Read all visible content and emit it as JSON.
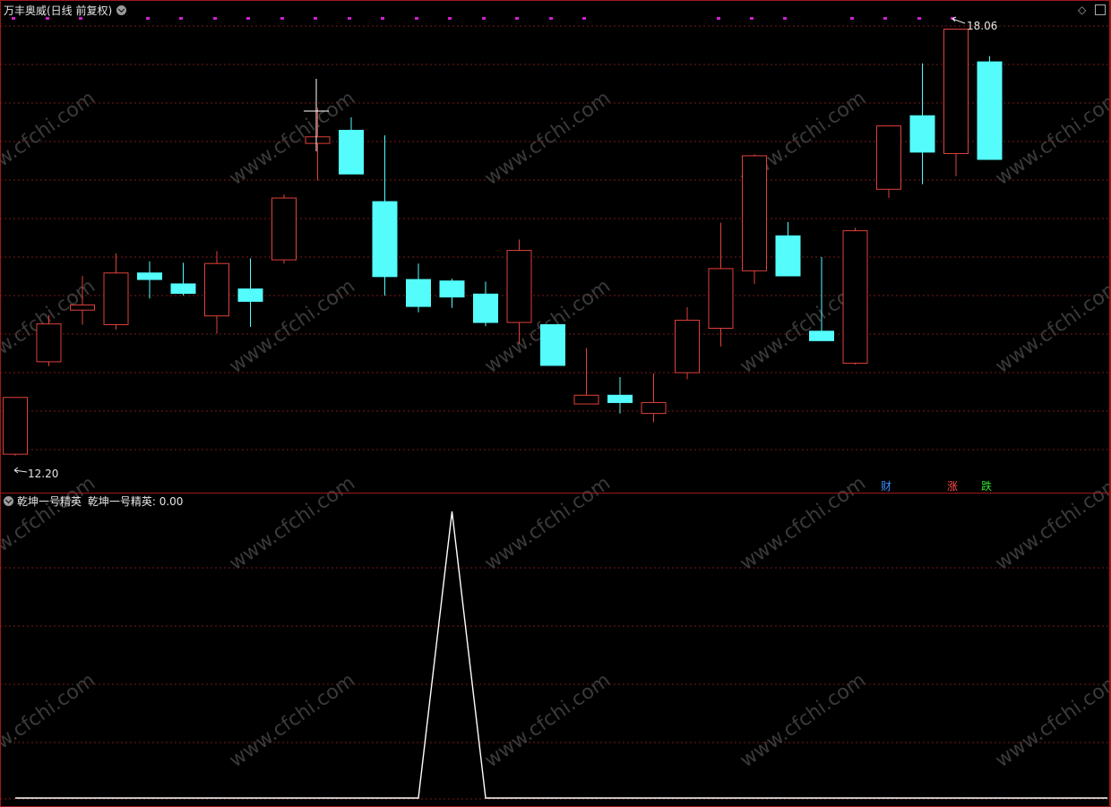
{
  "main_panel": {
    "title": "万丰奥威(日线 前复权)",
    "high_label": "18.06",
    "low_label": "12.20",
    "markers": [
      {
        "text": "财",
        "color": "#3f8cff"
      },
      {
        "text": "涨",
        "color": "#ff4b4b"
      },
      {
        "text": "跌",
        "color": "#2fdf2f"
      }
    ]
  },
  "indicator_panel": {
    "title": "乾坤一号精英",
    "value_label": "乾坤一号精英: 0.00"
  },
  "watermark": "www.cfchi.com",
  "colors": {
    "up": "#e0413a",
    "down": "#54fcfc",
    "grid": "#7a1a1a",
    "border": "#a01818",
    "dot": "#d21ed2",
    "line": "#ffffff"
  },
  "chart_data": [
    {
      "type": "candlestick",
      "title": "万丰奥威(日线 前复权)",
      "ylim": [
        12.0,
        18.3
      ],
      "candles": [
        {
          "o": 12.22,
          "h": 13.0,
          "l": 12.2,
          "c": 13.0,
          "dir": "up"
        },
        {
          "o": 13.49,
          "h": 14.13,
          "l": 13.43,
          "c": 14.01,
          "dir": "up"
        },
        {
          "o": 14.2,
          "h": 14.67,
          "l": 14.0,
          "c": 14.27,
          "dir": "up"
        },
        {
          "o": 14.0,
          "h": 14.98,
          "l": 13.93,
          "c": 14.71,
          "dir": "up"
        },
        {
          "o": 14.71,
          "h": 14.87,
          "l": 14.36,
          "c": 14.62,
          "dir": "down"
        },
        {
          "o": 14.56,
          "h": 14.85,
          "l": 14.4,
          "c": 14.43,
          "dir": "down"
        },
        {
          "o": 14.12,
          "h": 15.01,
          "l": 13.88,
          "c": 14.84,
          "dir": "up"
        },
        {
          "o": 14.49,
          "h": 14.91,
          "l": 13.97,
          "c": 14.32,
          "dir": "down"
        },
        {
          "o": 14.89,
          "h": 15.79,
          "l": 14.84,
          "c": 15.74,
          "dir": "up"
        },
        {
          "o": 16.49,
          "h": 16.98,
          "l": 15.98,
          "c": 16.58,
          "dir": "up"
        },
        {
          "o": 16.67,
          "h": 16.85,
          "l": 16.09,
          "c": 16.07,
          "dir": "down"
        },
        {
          "o": 15.69,
          "h": 16.6,
          "l": 14.4,
          "c": 14.66,
          "dir": "down"
        },
        {
          "o": 14.62,
          "h": 14.84,
          "l": 14.17,
          "c": 14.25,
          "dir": "down"
        },
        {
          "o": 14.6,
          "h": 14.63,
          "l": 14.23,
          "c": 14.38,
          "dir": "down"
        },
        {
          "o": 14.42,
          "h": 14.59,
          "l": 13.98,
          "c": 14.03,
          "dir": "down"
        },
        {
          "o": 14.03,
          "h": 15.17,
          "l": 13.73,
          "c": 15.02,
          "dir": "up"
        },
        {
          "o": 14.0,
          "h": 14.0,
          "l": 13.44,
          "c": 13.44,
          "dir": "down"
        },
        {
          "o": 12.91,
          "h": 13.68,
          "l": 12.91,
          "c": 13.03,
          "dir": "up"
        },
        {
          "o": 13.03,
          "h": 13.28,
          "l": 12.78,
          "c": 12.93,
          "dir": "down"
        },
        {
          "o": 12.78,
          "h": 13.33,
          "l": 12.66,
          "c": 12.93,
          "dir": "up"
        },
        {
          "o": 13.34,
          "h": 14.24,
          "l": 13.25,
          "c": 14.06,
          "dir": "up"
        },
        {
          "o": 13.95,
          "h": 15.4,
          "l": 13.7,
          "c": 14.77,
          "dir": "up"
        },
        {
          "o": 14.74,
          "h": 16.34,
          "l": 14.56,
          "c": 16.32,
          "dir": "up"
        },
        {
          "o": 15.22,
          "h": 15.41,
          "l": 14.69,
          "c": 14.67,
          "dir": "down"
        },
        {
          "o": 13.91,
          "h": 14.93,
          "l": 13.9,
          "c": 13.78,
          "dir": "down"
        },
        {
          "o": 13.47,
          "h": 15.33,
          "l": 13.45,
          "c": 15.29,
          "dir": "up"
        },
        {
          "o": 15.86,
          "h": 16.64,
          "l": 15.74,
          "c": 16.73,
          "dir": "up"
        },
        {
          "o": 16.87,
          "h": 17.59,
          "l": 15.93,
          "c": 16.37,
          "dir": "down"
        },
        {
          "o": 16.35,
          "h": 18.06,
          "l": 16.04,
          "c": 18.06,
          "dir": "up"
        },
        {
          "o": 17.61,
          "h": 17.69,
          "l": 16.27,
          "c": 16.27,
          "dir": "down"
        }
      ]
    },
    {
      "type": "line",
      "title": "乾坤一号精英",
      "ylim": [
        0,
        1
      ],
      "series": [
        {
          "name": "乾坤一号精英",
          "values": [
            0,
            0,
            0,
            0,
            0,
            0,
            0,
            0,
            0,
            0,
            0,
            0,
            0,
            1,
            0,
            0,
            0,
            0,
            0,
            0,
            0,
            0,
            0,
            0,
            0,
            0,
            0,
            0,
            0,
            0
          ]
        }
      ]
    }
  ]
}
